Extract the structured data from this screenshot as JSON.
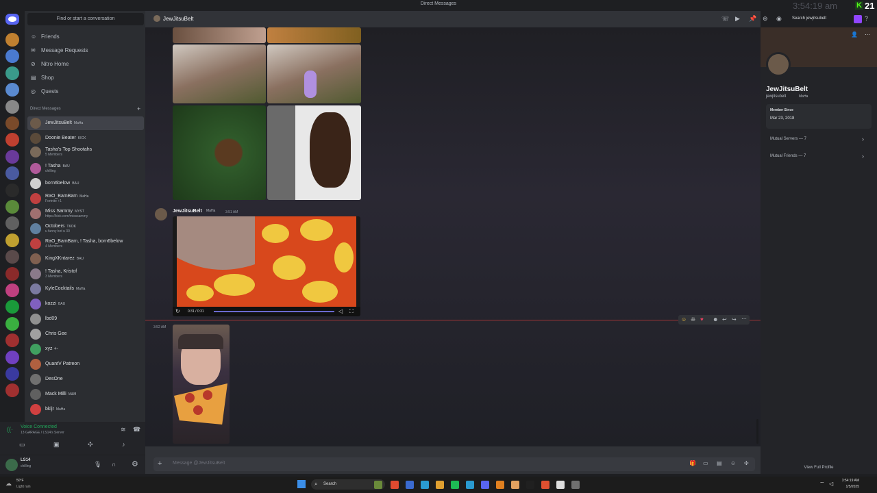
{
  "window": {
    "title": "Direct Messages",
    "clock_overlay": "3:54:19 am",
    "twitch_count": "21",
    "search_placeholder": "Search jewjitsubelt"
  },
  "sidebar": {
    "search_placeholder": "Find or start a conversation",
    "nav": [
      {
        "label": "Friends",
        "icon": "friends-icon"
      },
      {
        "label": "Message Requests",
        "icon": "mail-icon"
      },
      {
        "label": "Nitro Home",
        "icon": "nitro-icon"
      },
      {
        "label": "Shop",
        "icon": "shop-icon"
      },
      {
        "label": "Quests",
        "icon": "quests-icon"
      }
    ],
    "dm_header": "Direct Messages",
    "dms": [
      {
        "name": "JewJitsuBelt",
        "tag": "MaHa",
        "sub": "",
        "active": true,
        "color": "#6b5a4a"
      },
      {
        "name": "Doonie Beater",
        "tag": "KICK",
        "sub": "",
        "color": "#5a4a3a"
      },
      {
        "name": "Tasha's Top Shootahs",
        "tag": "",
        "sub": "5 Members",
        "color": "#7a6a5a"
      },
      {
        "name": "! Tasha",
        "tag": "BAU",
        "sub": "chilling",
        "color": "#b05a9a"
      },
      {
        "name": "born6below",
        "tag": "BAU",
        "sub": "",
        "color": "#d0d0d0"
      },
      {
        "name": "RaO_BamBam",
        "tag": "MaHa",
        "sub": "Fortnite +1",
        "color": "#c04040"
      },
      {
        "name": "Miss Sammy",
        "tag": "MYST",
        "sub": "https://kick.com/misssammy",
        "color": "#a07070"
      },
      {
        "name": "Octobers",
        "tag": "TKOK",
        "sub": "u funny bot u 30",
        "color": "#6080a0"
      },
      {
        "name": "RaO_BamBam, ! Tasha, born6below",
        "tag": "",
        "sub": "4 Members",
        "color": "#c04040"
      },
      {
        "name": "KingXKntarez",
        "tag": "BAU",
        "sub": "",
        "color": "#806050"
      },
      {
        "name": "! Tasha, Kristof",
        "tag": "",
        "sub": "3 Members",
        "color": "#8a7a8a"
      },
      {
        "name": "KyleCocktails",
        "tag": "MaHa",
        "sub": "",
        "color": "#7a7aa0"
      },
      {
        "name": "kozzi",
        "tag": "BAU",
        "sub": "",
        "color": "#8060c0"
      },
      {
        "name": "lbd09",
        "tag": "",
        "sub": "",
        "color": "#909090"
      },
      {
        "name": "Chris Gee",
        "tag": "",
        "sub": "",
        "color": "#a0a0a0"
      },
      {
        "name": "xyz +-",
        "tag": "",
        "sub": "",
        "color": "#40a060"
      },
      {
        "name": "QuantV Patreon",
        "tag": "",
        "sub": "",
        "color": "#b06040"
      },
      {
        "name": "DesOne",
        "tag": "",
        "sub": "",
        "color": "#707070"
      },
      {
        "name": "Mack Milli",
        "tag": "M&M",
        "sub": "",
        "color": "#606060"
      },
      {
        "name": "bkljr",
        "tag": "MaHa",
        "sub": "",
        "color": "#d04040"
      }
    ]
  },
  "voice": {
    "status": "Voice Connected",
    "server": "13 GARAGE / LS14's Server"
  },
  "user": {
    "name": "LS14",
    "status": "chilling"
  },
  "channel": {
    "name": "JewJitsuBelt"
  },
  "messages": [
    {
      "author": "JewJitsuBelt",
      "tag": "MaHa",
      "time": "3:51 AM",
      "video_time": "0:31 / 0:31"
    },
    {
      "time": "3:52 AM"
    }
  ],
  "composer": {
    "placeholder": "Message @JewJitsuBelt"
  },
  "profile": {
    "display_name": "JewJitsuBelt",
    "username": "jewjitsubelt",
    "tag": "MaHa",
    "member_since_label": "Member Since",
    "member_since": "Mar 23, 2018",
    "mutual_servers": "Mutual Servers — 7",
    "mutual_friends": "Mutual Friends — 7",
    "view_full": "View Full Profile"
  },
  "taskbar": {
    "weather_temp": "50°F",
    "weather_desc": "Light rain",
    "search": "Search",
    "time": "3:54:19 AM",
    "date": "1/5/2025"
  }
}
